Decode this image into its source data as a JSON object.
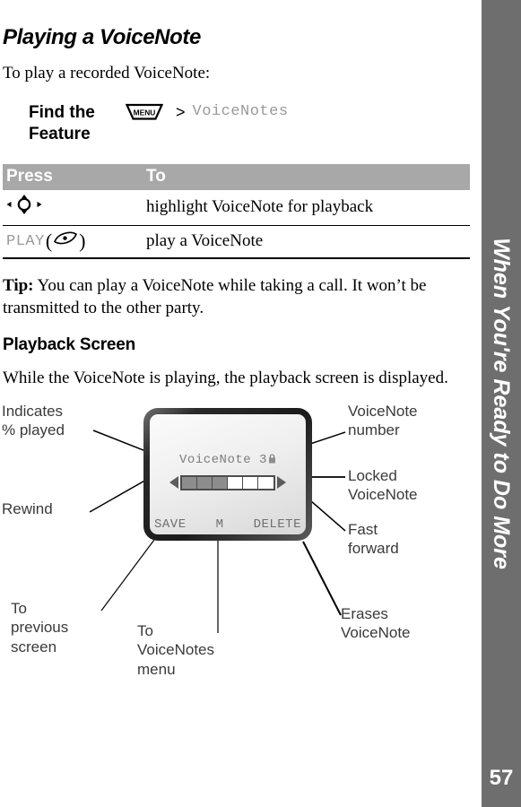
{
  "page": {
    "title": "Playing a VoiceNote",
    "intro": "To play a recorded VoiceNote:",
    "page_number": "57",
    "side_tab_text": "When You're Ready to Do More"
  },
  "find_feature": {
    "label": "Find the Feature",
    "menu_key_label": "MENU",
    "separator": ">",
    "path_item": "VoiceNotes"
  },
  "press_table": {
    "headers": [
      "Press",
      "To"
    ],
    "rows": [
      {
        "press_icon": "navigation-key-icon",
        "press_label": "",
        "to": "highlight VoiceNote for playback"
      },
      {
        "press_icon": "soft-key-icon",
        "press_label": "PLAY",
        "to": "play a VoiceNote"
      }
    ]
  },
  "tip": {
    "label": "Tip:",
    "text": " You can play a VoiceNote while taking a call. It won’t be transmitted to the other party."
  },
  "playback_section": {
    "heading": "Playback Screen",
    "description": "While the VoiceNote is playing, the playback screen is displayed."
  },
  "phone_screen": {
    "title": "VoiceNote 3",
    "lock_icon": "padlock-icon",
    "progress_total_segments": 6,
    "progress_filled_segments": 3,
    "rewind_icon": "rewind-triangle-icon",
    "fast_forward_icon": "fast-forward-triangle-icon",
    "softkeys": {
      "left": "SAVE",
      "center": "M",
      "right": "DELETE"
    }
  },
  "callouts": {
    "indicates_percent": "Indicates\n% played",
    "rewind": "Rewind",
    "to_previous_screen": "To\nprevious\nscreen",
    "to_voicenotes_menu": "To\nVoiceNotes\nmenu",
    "voicenote_number": "VoiceNote\nnumber",
    "locked_voicenote": "Locked\nVoiceNote",
    "fast_forward": "Fast\nforward",
    "erases_voicenote": "Erases\nVoiceNote"
  },
  "colors": {
    "side_tab": "#6e6e6e",
    "table_header": "#a8a8a8",
    "mono_text": "#9a9a9a",
    "callout_text": "#3a3a3a"
  }
}
